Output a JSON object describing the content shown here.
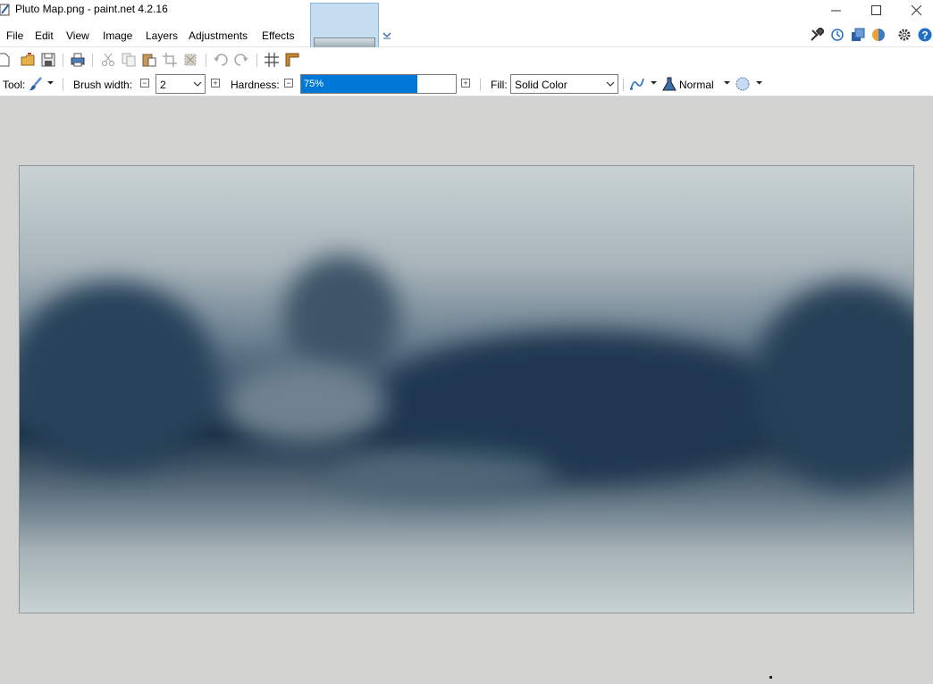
{
  "window": {
    "title": "Pluto Map.png - paint.net 4.2.16",
    "buttons": [
      "minimize",
      "maximize",
      "close"
    ]
  },
  "menu": {
    "items": [
      "File",
      "Edit",
      "View",
      "Image",
      "Layers",
      "Adjustments",
      "Effects"
    ]
  },
  "right_icons": [
    "tools-icon",
    "history-icon",
    "layers-icon",
    "colors-icon",
    "settings-icon",
    "help-icon"
  ],
  "toolbar": {
    "icons": [
      "new-icon",
      "open-icon",
      "save-icon",
      "print-icon",
      "cut-icon",
      "copy-icon",
      "paste-icon",
      "crop-icon",
      "deselect-icon",
      "undo-icon",
      "redo-icon",
      "grid-icon",
      "ruler-icon"
    ]
  },
  "tool_options": {
    "tool_label": "Tool:",
    "brush_width_label": "Brush width:",
    "brush_width_value": "2",
    "hardness_label": "Hardness:",
    "hardness_value": "75%",
    "hardness_fraction": 0.75,
    "fill_label": "Fill:",
    "fill_value": "Solid Color",
    "blend_mode": "Normal"
  },
  "colors": {
    "accent": "#0078d7",
    "thumb_bg": "#c4ddf1",
    "workspace": "#d2d2d0"
  }
}
